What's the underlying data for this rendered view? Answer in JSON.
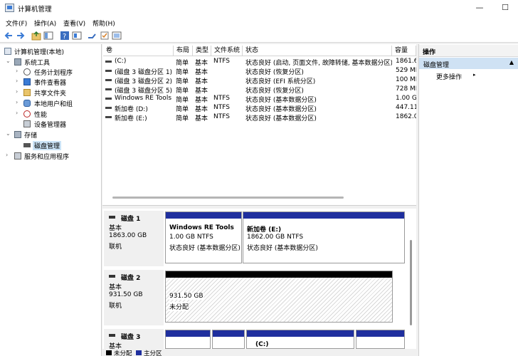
{
  "window": {
    "title": "计算机管理",
    "minimize": "—",
    "maximize": "☐",
    "close": "✕"
  },
  "menu": [
    "文件(F)",
    "操作(A)",
    "查看(V)",
    "帮助(H)"
  ],
  "tree": {
    "root": "计算机管理(本地)",
    "items": [
      {
        "label": "系统工具",
        "icon": "tools-icon"
      },
      {
        "label": "任务计划程序",
        "icon": "clock-icon"
      },
      {
        "label": "事件查看器",
        "icon": "event-viewer-icon"
      },
      {
        "label": "共享文件夹",
        "icon": "shared-folder-icon"
      },
      {
        "label": "本地用户和组",
        "icon": "users-icon"
      },
      {
        "label": "性能",
        "icon": "performance-icon"
      },
      {
        "label": "设备管理器",
        "icon": "device-manager-icon"
      },
      {
        "label": "存储",
        "icon": "storage-icon"
      },
      {
        "label": "磁盘管理",
        "icon": "disk-management-icon"
      },
      {
        "label": "服务和应用程序",
        "icon": "services-icon"
      }
    ]
  },
  "list": {
    "columns": [
      "卷",
      "布局",
      "类型",
      "文件系统",
      "状态",
      "容量"
    ],
    "rows": [
      [
        "(C:)",
        "简单",
        "基本",
        "NTFS",
        "状态良好 (启动, 页面文件, 故障转储, 基本数据分区)",
        "1861.6"
      ],
      [
        "(磁盘 3 磁盘分区 1)",
        "简单",
        "基本",
        "",
        "状态良好 (恢复分区)",
        "529 MI"
      ],
      [
        "(磁盘 3 磁盘分区 2)",
        "简单",
        "基本",
        "",
        "状态良好 (EFI 系统分区)",
        "100 MI"
      ],
      [
        "(磁盘 3 磁盘分区 5)",
        "简单",
        "基本",
        "",
        "状态良好 (恢复分区)",
        "728 MI"
      ],
      [
        "Windows RE Tools",
        "简单",
        "基本",
        "NTFS",
        "状态良好 (基本数据分区)",
        "1.00 GI"
      ],
      [
        "新加卷 (D:)",
        "简单",
        "基本",
        "NTFS",
        "状态良好 (基本数据分区)",
        "447.11"
      ],
      [
        "新加卷 (E:)",
        "简单",
        "基本",
        "NTFS",
        "状态良好 (基本数据分区)",
        "1862.0"
      ]
    ]
  },
  "disks": [
    {
      "name": "磁盘 1",
      "type": "基本",
      "size": "1863.00 GB",
      "status": "联机",
      "partitions": [
        {
          "name": "Windows RE Tools",
          "size": "1.00 GB NTFS",
          "status": "状态良好 (基本数据分区)"
        },
        {
          "name": "新加卷  (E:)",
          "size": "1862.00 GB NTFS",
          "status": "状态良好 (基本数据分区)"
        }
      ]
    },
    {
      "name": "磁盘 2",
      "type": "基本",
      "size": "931.50 GB",
      "status": "联机",
      "partitions": [
        {
          "size": "931.50 GB",
          "status": "未分配"
        }
      ]
    },
    {
      "name": "磁盘 3",
      "type": "基本",
      "partitions": [
        {
          "name": "(C:)"
        }
      ]
    }
  ],
  "legend": [
    "未分配",
    "主分区"
  ],
  "colors": {
    "unallocated": "#000000",
    "primary": "#1f2f9e",
    "selection": "#cfe2f4"
  },
  "actions": {
    "header": "操作",
    "section": "磁盘管理",
    "more": "更多操作"
  }
}
